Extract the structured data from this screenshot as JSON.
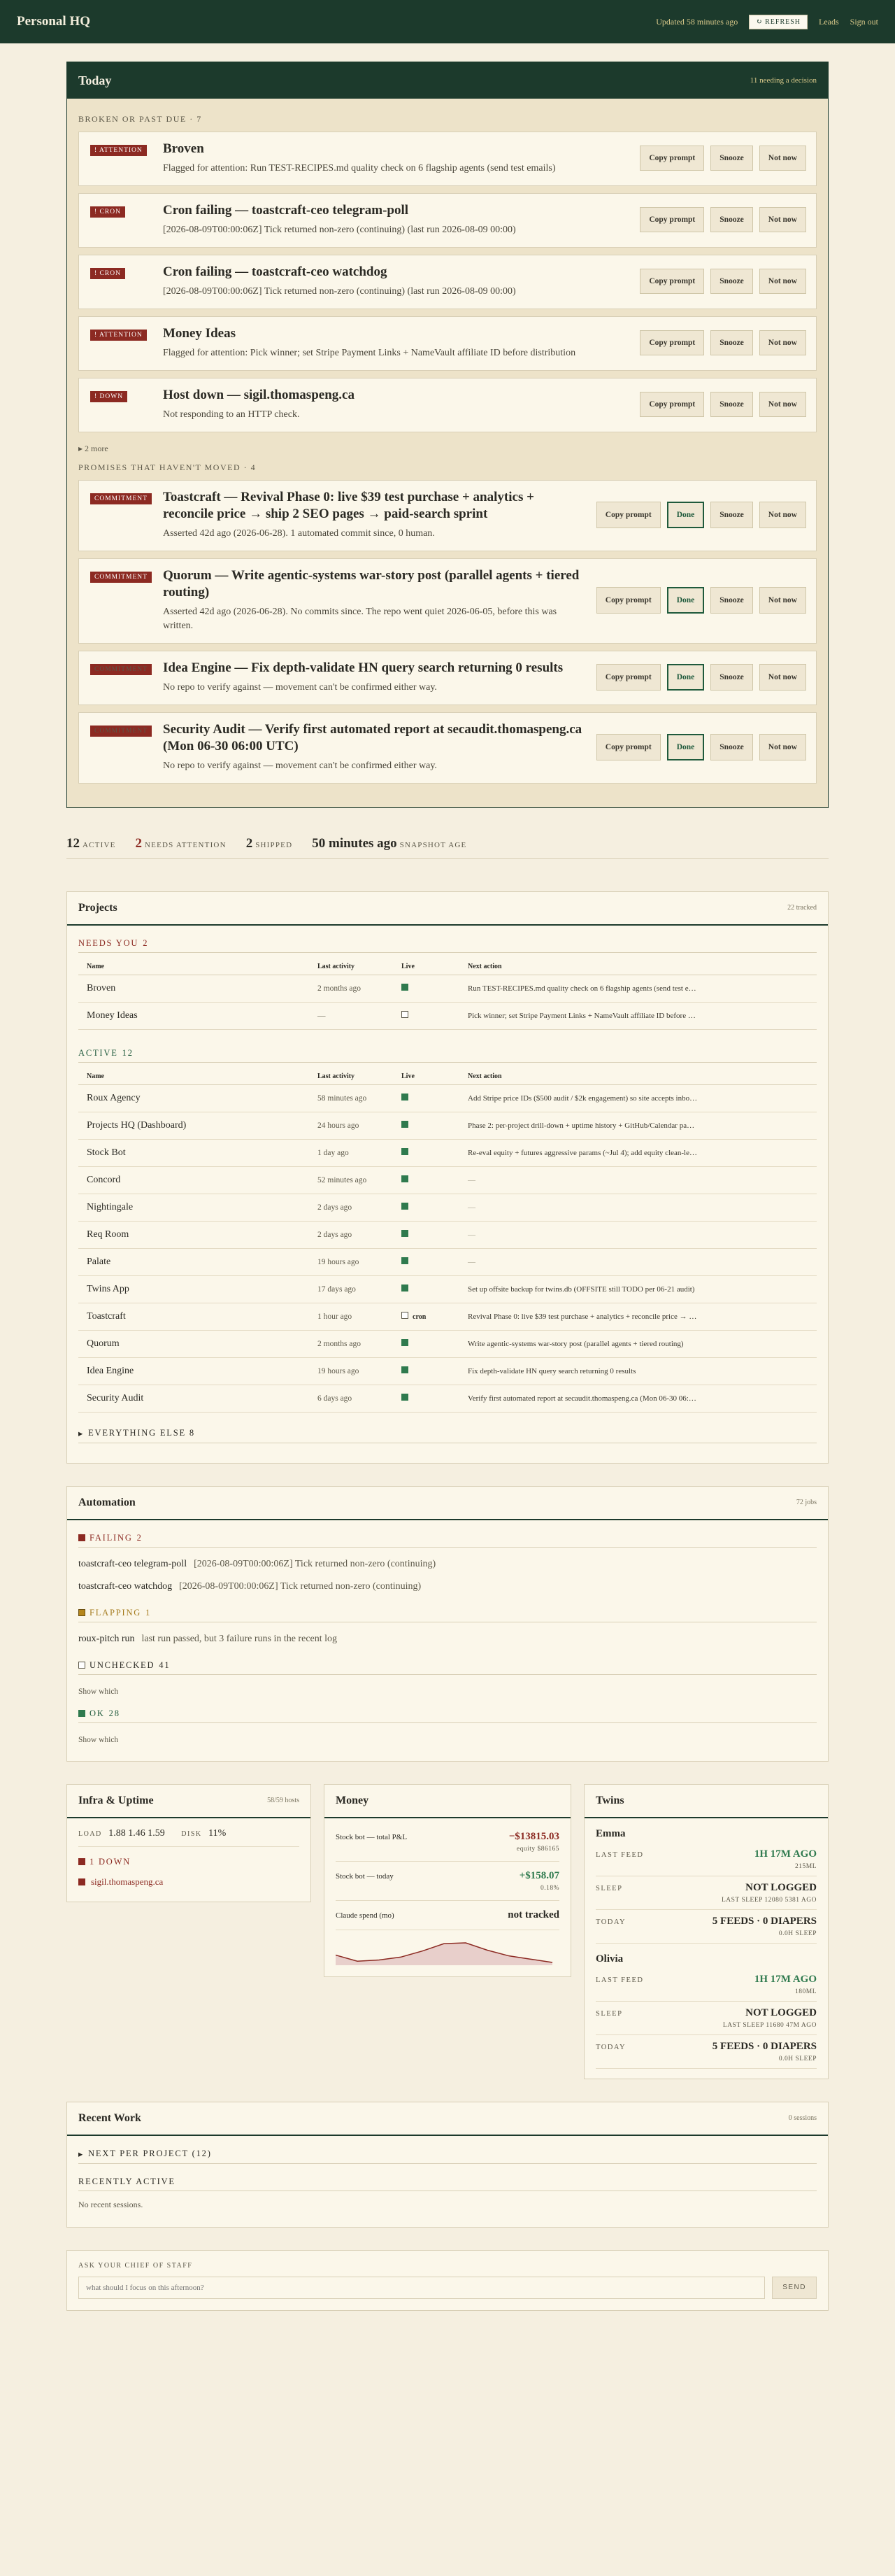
{
  "header": {
    "brand": "Personal HQ",
    "updated": "Updated 58 minutes ago",
    "refresh": "↻ REFRESH",
    "nav": [
      "Leads",
      "Sign out"
    ]
  },
  "today": {
    "title": "Today",
    "subtitle": "11 needing a decision",
    "broken_label": "BROKEN OR PAST DUE · 7",
    "broken": [
      {
        "badge": "! ATTENTION",
        "title": "Broven",
        "desc": "Flagged for attention: Run TEST-RECIPES.md quality check on 6 flagship agents (send test emails)"
      },
      {
        "badge": "! CRON",
        "title": "Cron failing — toastcraft-ceo telegram-poll",
        "desc": "[2026-08-09T00:00:06Z] Tick returned non-zero (continuing) (last run 2026-08-09 00:00)"
      },
      {
        "badge": "! CRON",
        "title": "Cron failing — toastcraft-ceo watchdog",
        "desc": "[2026-08-09T00:00:06Z] Tick returned non-zero (continuing) (last run 2026-08-09 00:00)"
      },
      {
        "badge": "! ATTENTION",
        "title": "Money Ideas",
        "desc": "Flagged for attention: Pick winner; set Stripe Payment Links + NameVault affiliate ID before distribution"
      },
      {
        "badge": "! DOWN",
        "title": "Host down — sigil.thomaspeng.ca",
        "desc": "Not responding to an HTTP check."
      }
    ],
    "more": "2 more",
    "promises_label": "PROMISES THAT HAVEN'T MOVED · 4",
    "promises": [
      {
        "badge": "COMMITMENT",
        "title": "Toastcraft — Revival Phase 0: live $39 test purchase + analytics + reconcile price → ship 2 SEO pages → paid-search sprint",
        "desc": "Asserted 42d ago (2026-06-28). 1 automated commit since, 0 human."
      },
      {
        "badge": "COMMITMENT",
        "title": "Quorum — Write agentic-systems war-story post (parallel agents + tiered routing)",
        "desc": "Asserted 42d ago (2026-06-28). No commits since. The repo went quiet 2026-06-05, before this was written."
      },
      {
        "badge": "COMMITMENT",
        "title": "Idea Engine — Fix depth-validate HN query search returning 0 results",
        "desc": "No repo to verify against — movement can't be confirmed either way."
      },
      {
        "badge": "COMMITMENT",
        "title": "Security Audit — Verify first automated report at secaudit.thomaspeng.ca (Mon 06-30 06:00 UTC)",
        "desc": "No repo to verify against — movement can't be confirmed either way."
      }
    ],
    "btn_copy": "Copy prompt",
    "btn_done": "Done",
    "btn_snooze": "Snooze",
    "btn_notnow": "Not now"
  },
  "stats": [
    {
      "n": "12",
      "l": "ACTIVE"
    },
    {
      "n": "2",
      "l": "NEEDS ATTENTION"
    },
    {
      "n": "2",
      "l": "SHIPPED"
    },
    {
      "n": "50 minutes ago",
      "l": "SNAPSHOT AGE"
    }
  ],
  "projects": {
    "title": "Projects",
    "subtitle": "22 tracked",
    "needs_label": "NEEDS YOU",
    "needs_count": "2",
    "active_label": "ACTIVE",
    "active_count": "12",
    "cols": [
      "Name",
      "Last activity",
      "Live",
      "Next action"
    ],
    "needs": [
      {
        "name": "Broven",
        "act": "2 months ago",
        "live": "up",
        "next": "Run TEST-RECIPES.md quality check on 6 flagship agents (send test e…"
      },
      {
        "name": "Money Ideas",
        "act": "—",
        "live": "none",
        "next": "Pick winner; set Stripe Payment Links + NameVault affiliate ID before …"
      }
    ],
    "active": [
      {
        "name": "Roux Agency",
        "act": "58 minutes ago",
        "live": "up",
        "next": "Add Stripe price IDs ($500 audit / $2k engagement) so site accepts inbo…"
      },
      {
        "name": "Projects HQ (Dashboard)",
        "act": "24 hours ago",
        "live": "up",
        "next": "Phase 2: per-project drill-down + uptime history + GitHub/Calendar pa…"
      },
      {
        "name": "Stock Bot",
        "act": "1 day ago",
        "live": "up",
        "next": "Re-eval equity + futures aggressive params (~Jul 4); add equity clean-le…"
      },
      {
        "name": "Concord",
        "act": "52 minutes ago",
        "live": "up",
        "next": "—"
      },
      {
        "name": "Nightingale",
        "act": "2 days ago",
        "live": "up",
        "next": "—"
      },
      {
        "name": "Req Room",
        "act": "2 days ago",
        "live": "up",
        "next": "—"
      },
      {
        "name": "Palate",
        "act": "19 hours ago",
        "live": "up",
        "next": "—"
      },
      {
        "name": "Twins App",
        "act": "17 days ago",
        "live": "up",
        "next": "Set up offsite backup for twins.db (OFFSITE still TODO per 06-21 audit)"
      },
      {
        "name": "Toastcraft",
        "act": "1 hour ago",
        "live": "cron",
        "next": "Revival Phase 0: live $39 test purchase + analytics + reconcile price → …"
      },
      {
        "name": "Quorum",
        "act": "2 months ago",
        "live": "up",
        "next": "Write agentic-systems war-story post (parallel agents + tiered routing)"
      },
      {
        "name": "Idea Engine",
        "act": "19 hours ago",
        "live": "up",
        "next": "Fix depth-validate HN query search returning 0 results"
      },
      {
        "name": "Security Audit",
        "act": "6 days ago",
        "live": "up",
        "next": "Verify first automated report at secaudit.thomaspeng.ca (Mon 06-30 06:…"
      }
    ],
    "cron_tag": "cron",
    "everything": "EVERYTHING ELSE 8"
  },
  "automation": {
    "title": "Automation",
    "subtitle": "72 jobs",
    "failing_label": "FAILING",
    "failing_count": "2",
    "failing": [
      {
        "name": "toastcraft-ceo telegram-poll",
        "err": "[2026-08-09T00:00:06Z] Tick returned non-zero (continuing)"
      },
      {
        "name": "toastcraft-ceo watchdog",
        "err": "[2026-08-09T00:00:06Z] Tick returned non-zero (continuing)"
      }
    ],
    "flapping_label": "FLAPPING",
    "flapping_count": "1",
    "flapping": [
      {
        "name": "roux-pitch run",
        "err": "last run passed, but 3 failure runs in the recent log"
      }
    ],
    "unchecked_label": "UNCHECKED",
    "unchecked_count": "41",
    "show1": "Show which",
    "ok_label": "OK",
    "ok_count": "28",
    "show2": "Show which"
  },
  "infra": {
    "title": "Infra & Uptime",
    "subtitle": "58/59 hosts",
    "load_label": "LOAD",
    "load": "1.88 1.46 1.59",
    "disk_label": "DISK",
    "disk": "11%",
    "down_label": "1 DOWN",
    "down_host": "sigil.thomaspeng.ca"
  },
  "money": {
    "title": "Money",
    "rows": [
      {
        "k": "Stock bot — total P&L",
        "v": "−$13815.03",
        "sub": "equity $86165"
      },
      {
        "k": "Stock bot — today",
        "v": "+$158.07",
        "sub": "0.18%"
      },
      {
        "k": "Claude spend (mo)",
        "v": "not tracked",
        "sub": ""
      }
    ],
    "spark": [
      40,
      55,
      52,
      45,
      30,
      12,
      10,
      28,
      42,
      50,
      58
    ]
  },
  "twins": {
    "title": "Twins",
    "kids": [
      {
        "name": "Emma",
        "feed_k": "LAST FEED",
        "feed": "1H 17M AGO",
        "feed_sub": "215ML",
        "sleep_k": "SLEEP",
        "sleep": "NOT LOGGED",
        "sleep_sub": "LAST SLEEP 12080 5381 AGO",
        "today_k": "TODAY",
        "today": "5 FEEDS · 0 DIAPERS",
        "today_sub": "0.0H SLEEP"
      },
      {
        "name": "Olivia",
        "feed_k": "LAST FEED",
        "feed": "1H 17M AGO",
        "feed_sub": "180ML",
        "sleep_k": "SLEEP",
        "sleep": "NOT LOGGED",
        "sleep_sub": "LAST SLEEP 11680 47M AGO",
        "today_k": "TODAY",
        "today": "5 FEEDS · 0 DIAPERS",
        "today_sub": "0.0H SLEEP"
      }
    ]
  },
  "recent": {
    "title": "Recent Work",
    "subtitle": "0 sessions",
    "next_label": "NEXT PER PROJECT (12)",
    "recently_label": "RECENTLY ACTIVE",
    "none": "No recent sessions."
  },
  "ask": {
    "label": "ASK YOUR CHIEF OF STAFF",
    "placeholder": "what should I focus on this afternoon?",
    "send": "SEND"
  }
}
